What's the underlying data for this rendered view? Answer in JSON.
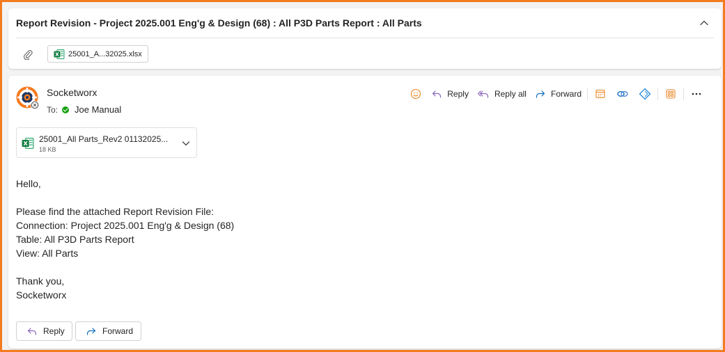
{
  "conversation": {
    "subject": "Report Revision - Project 2025.001 Eng'g & Design (68) : All P3D Parts Report : All Parts",
    "attachment_chip": "25001_A...32025.xlsx"
  },
  "message": {
    "sender": "Socketworx",
    "to_label": "To:",
    "recipient": "Joe Manual",
    "toolbar": {
      "reply": "Reply",
      "reply_all": "Reply all",
      "forward": "Forward"
    },
    "attachment": {
      "name": "25001_All Parts_Rev2 01132025...",
      "size": "18 KB"
    },
    "body": {
      "greeting": "Hello,",
      "line1": "Please find the attached Report Revision File:",
      "line2": "Connection: Project 2025.001 Eng'g & Design (68)",
      "line3": "Table: All P3D Parts Report",
      "line4": "View: All Parts",
      "closing": "Thank you,",
      "signature": "Socketworx"
    },
    "bottom_buttons": {
      "reply": "Reply",
      "forward": "Forward"
    }
  },
  "colors": {
    "frame_border": "#f47b20",
    "accent_blue": "#0f6cbd",
    "reply_purple": "#8764b8",
    "excel_green": "#107c41",
    "presence_green": "#13a10e",
    "emoji_orange": "#e8821c"
  },
  "icons": {
    "collapse": "chevron-up-icon",
    "attachment": "paperclip-icon",
    "excel": "excel-file-icon",
    "emoji": "emoji-icon",
    "reply": "reply-arrow-icon",
    "reply_all": "reply-all-arrow-icon",
    "forward": "forward-arrow-icon",
    "calendar": "calendar-icon",
    "link": "link-icon",
    "diamond": "diamond-app-icon",
    "apps": "apps-icon",
    "more": "more-ellipsis-icon",
    "dropdown": "chevron-down-icon"
  }
}
